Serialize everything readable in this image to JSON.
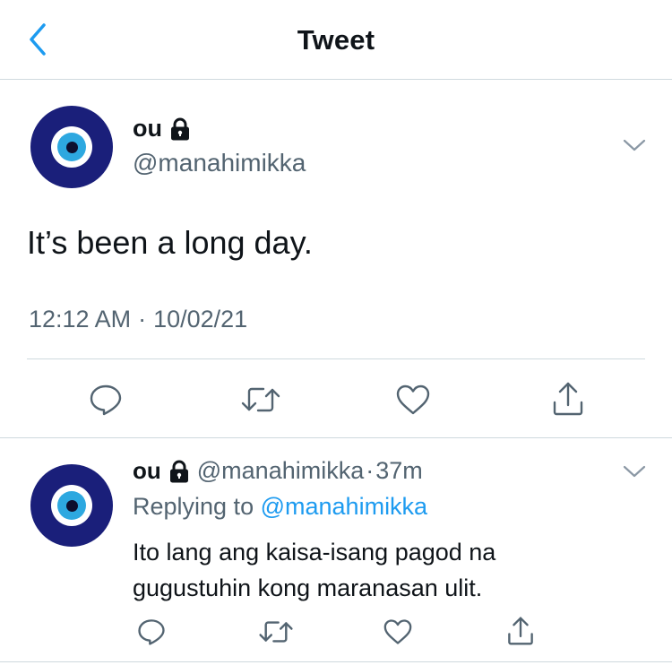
{
  "header": {
    "title": "Tweet"
  },
  "main_tweet": {
    "name": "ou",
    "handle": "@manahimikka",
    "text": "It’s been a long day.",
    "time": "12:12 AM",
    "separator": "·",
    "date": "10/02/21"
  },
  "reply": {
    "name": "ou",
    "handle": "@manahimikka",
    "separator": "·",
    "age": "37m",
    "replying_prefix": "Replying to",
    "replying_to": "@manahimikka",
    "text": "Ito lang ang kaisa-isang pagod na gugustuhin kong maranasan ulit."
  },
  "colors": {
    "accent": "#1d9bf0",
    "secondary_text": "#536471",
    "avatar_dark": "#1a1f7a",
    "avatar_iris": "#2da8e0"
  },
  "icons": {
    "back": "chevron-left-icon",
    "lock": "lock-icon",
    "more": "chevron-down-icon",
    "reply": "comment-icon",
    "retweet": "retweet-icon",
    "like": "heart-icon",
    "share": "share-icon"
  }
}
